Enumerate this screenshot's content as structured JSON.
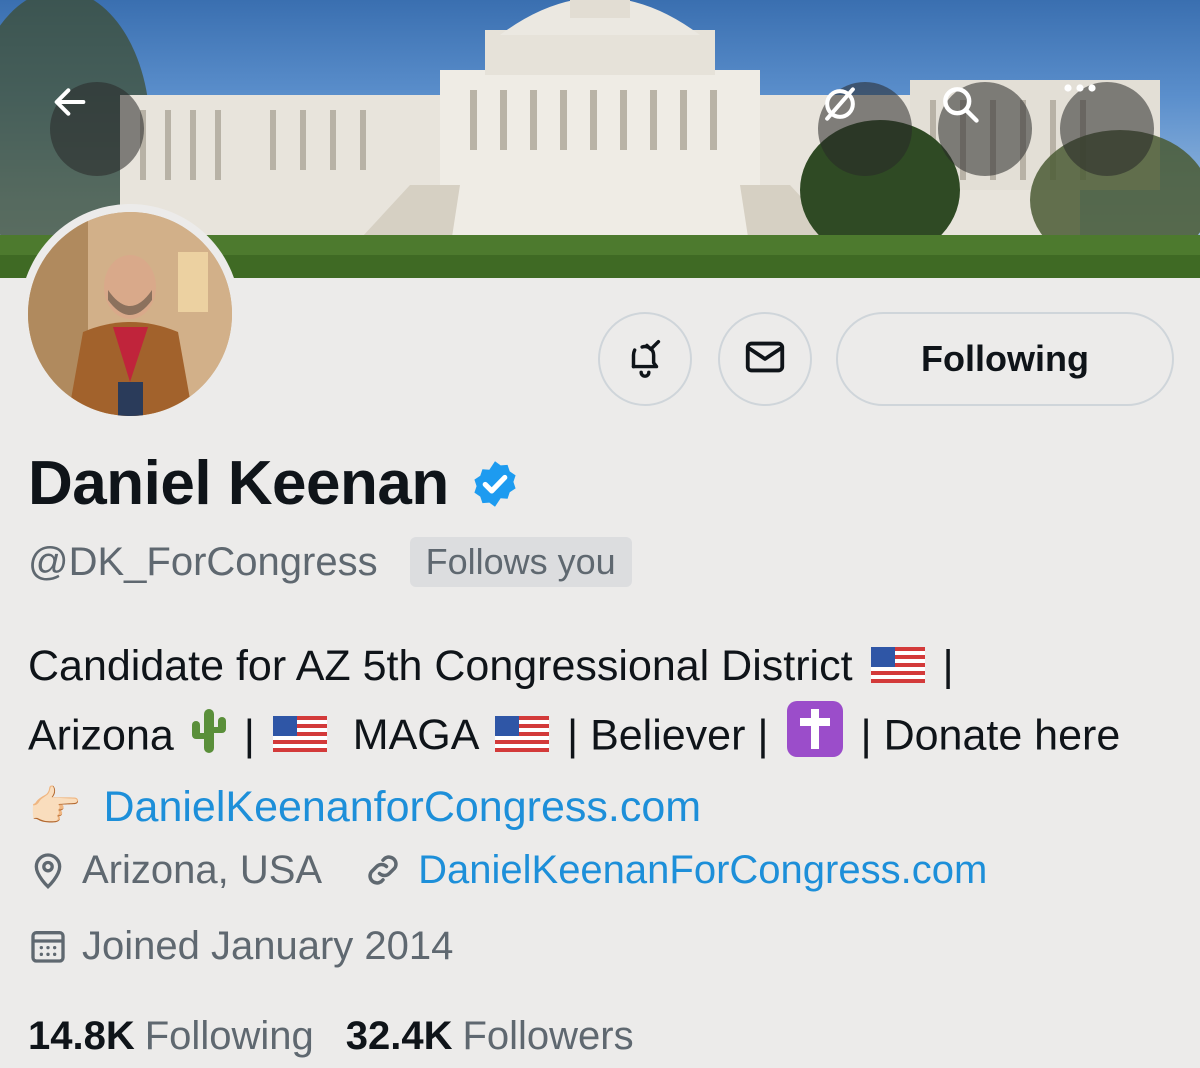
{
  "banner": {
    "back_icon": "arrow-left-icon",
    "actions": [
      "hide-reposts-icon",
      "search-icon",
      "more-icon"
    ]
  },
  "profile": {
    "name": "Daniel Keenan",
    "verified_icon": "verified-badge-icon",
    "handle": "@DK_ForCongress",
    "follows_you": "Follows you",
    "bio": {
      "line1_text": "Candidate for AZ 5th Congressional District",
      "sep": "|",
      "line2_a": "Arizona",
      "line2_b": "|",
      "line2_c": "MAGA",
      "line2_d": "| Believer |",
      "line2_e": "| Donate here",
      "pointer": "👉🏻",
      "link": "DanielKeenanforCongress.com"
    },
    "location": "Arizona, USA",
    "website": "DanielKeenanForCongress.com",
    "joined": "Joined January 2014",
    "following_count": "14.8K",
    "following_label": "Following",
    "followers_count": "32.4K",
    "followers_label": "Followers"
  },
  "buttons": {
    "notify_icon": "bell-check-icon",
    "message_icon": "envelope-icon",
    "follow_label": "Following"
  },
  "colors": {
    "link": "#1d8fd9",
    "verified": "#1d9bf0",
    "background": "#ecebea"
  }
}
